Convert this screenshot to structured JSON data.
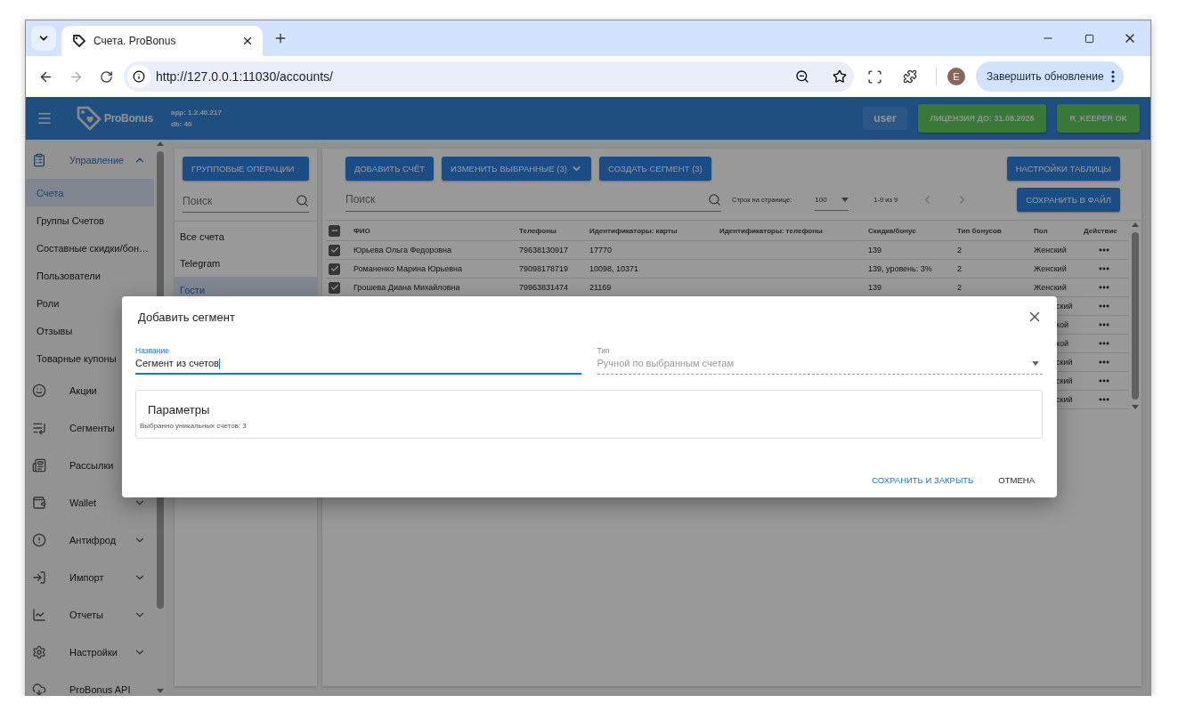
{
  "browser": {
    "tab_title": "Счета. ProBonus",
    "url": "http://127.0.0.1:11030/accounts/",
    "profile_initial": "E",
    "update_button": "Завершить обновление"
  },
  "header": {
    "brand": "ProBonus",
    "app_version": "app: 1.2.40.217",
    "db_version": "db: 40",
    "user": "user",
    "license": "ЛИЦЕНЗИЯ ДО: 31.08.2026",
    "pos_status": "R_KEEPER OK"
  },
  "sidebar": {
    "items": [
      {
        "label": "Управление",
        "expanded": true,
        "children": [
          {
            "label": "Счета",
            "selected": true
          },
          {
            "label": "Группы Счетов",
            "selected": false
          },
          {
            "label": "Составные скидки/бон…",
            "selected": false
          },
          {
            "label": "Пользователи",
            "selected": false
          },
          {
            "label": "Роли",
            "selected": false
          },
          {
            "label": "Отзывы",
            "selected": false
          },
          {
            "label": "Товарные купоны",
            "selected": false
          }
        ]
      },
      {
        "label": "Акции"
      },
      {
        "label": "Сегменты"
      },
      {
        "label": "Рассылки"
      },
      {
        "label": "Wallet",
        "expanded": false
      },
      {
        "label": "Антифрод",
        "expanded": false
      },
      {
        "label": "Импорт",
        "expanded": false
      },
      {
        "label": "Отчеты",
        "expanded": false
      },
      {
        "label": "Настройки",
        "expanded": false
      },
      {
        "label": "ProBonus API"
      }
    ]
  },
  "groups": {
    "operations_button": "ГРУППОВЫЕ ОПЕРАЦИИ",
    "search_placeholder": "Поиск",
    "items": [
      {
        "label": "Все счета",
        "selected": false
      },
      {
        "label": "Telegram",
        "selected": false
      },
      {
        "label": "Гости",
        "selected": true
      }
    ]
  },
  "toolbar": {
    "buttons": [
      {
        "label": "ДОБАВИТЬ СЧЁТ",
        "kind": "plain"
      },
      {
        "label": "ИЗМЕНИТЬ ВЫБРАННЫЕ (3)",
        "kind": "menu"
      },
      {
        "label": "СОЗДАТЬ СЕГМЕНТ (3)",
        "kind": "plain"
      }
    ],
    "table_settings": "НАСТРОЙКИ ТАБЛИЦЫ",
    "search_placeholder": "Поиск",
    "rows_per_page_label": "Строк на странице:",
    "rows_per_page": "100",
    "range": "1-9 из 9",
    "export_button": "СОХРАНИТЬ В ФАЙЛ"
  },
  "table": {
    "select_all": {
      "indeterminate": true
    },
    "columns": [
      "ФИО",
      "Телефоны",
      "Идентификаторы: карты",
      "Идентификаторы: телефоны",
      "Скидка/бонус",
      "Тип бонусов",
      "Пол",
      "Действие"
    ],
    "rows": [
      {
        "kind": "full",
        "checked": true,
        "cells": [
          "Юрьева Ольга Федоровна",
          "79638130917",
          "17770",
          "",
          "139",
          "2",
          "Женский"
        ]
      },
      {
        "kind": "full",
        "checked": true,
        "cells": [
          "Романенко Марина Юрьевна",
          "79098178719",
          "10098, 10371",
          "",
          "139, уровень: 3%",
          "2",
          "Женский"
        ]
      },
      {
        "kind": "full",
        "checked": true,
        "cells": [
          "Грошева Диана Михайловна",
          "79963831474",
          "21169",
          "",
          "139",
          "2",
          "Женский"
        ]
      },
      {
        "kind": "covered",
        "gender": "ский"
      },
      {
        "kind": "covered",
        "gender": "кой"
      },
      {
        "kind": "covered",
        "gender": "кой"
      },
      {
        "kind": "covered",
        "gender": "ский"
      },
      {
        "kind": "covered",
        "gender": "ский"
      },
      {
        "kind": "covered",
        "gender": "ский"
      }
    ]
  },
  "dialog": {
    "title": "Добавить сегмент",
    "name_field": {
      "label": "Название",
      "value": "Сегмент из счетов",
      "focused": true
    },
    "type_field": {
      "label": "Тип",
      "value": "Ручной по выбранным счетам",
      "disabled": true
    },
    "parameters": {
      "title": "Параметры",
      "note": "Выбранно уникальных счетов: 3"
    },
    "save_button": "СОХРАНИТЬ И ЗАКРЫТЬ",
    "cancel_button": "ОТМЕНА"
  }
}
